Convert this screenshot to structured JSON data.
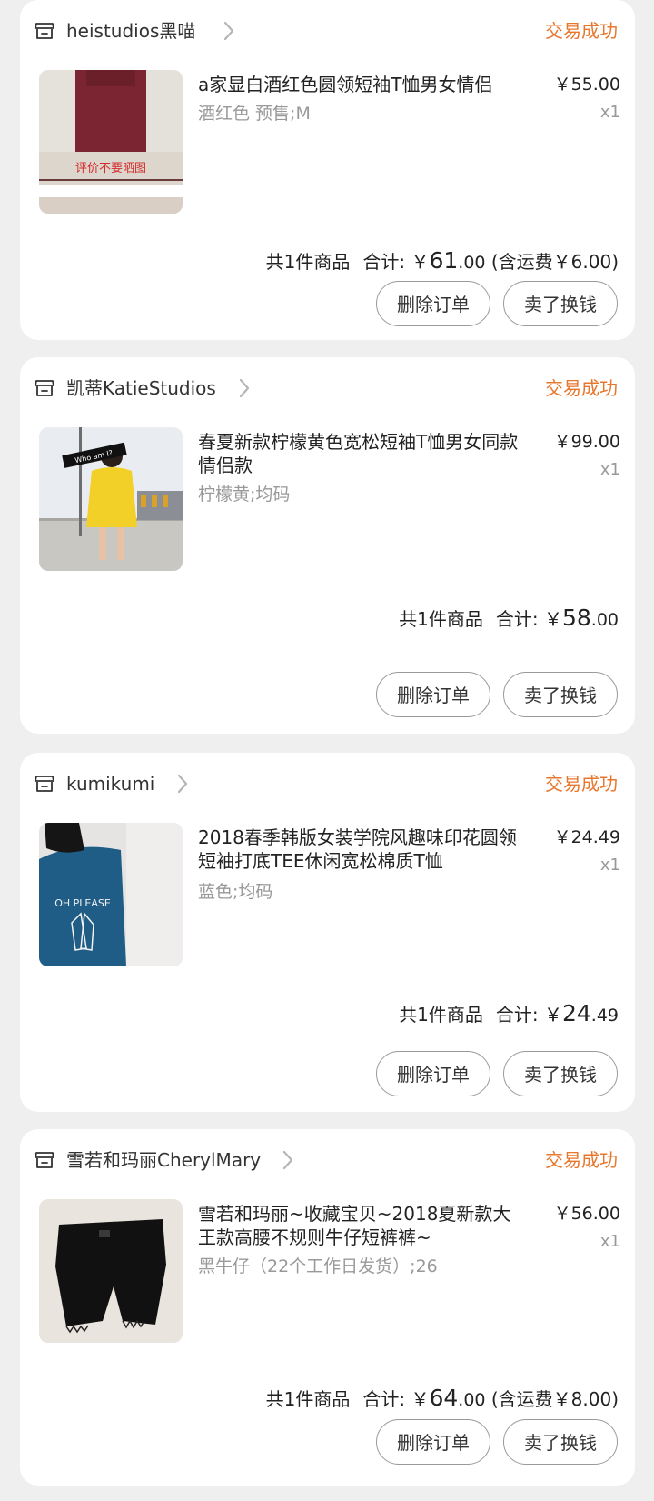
{
  "orders": [
    {
      "store_name": "heistudios黑喵",
      "status": "交易成功",
      "item_title": "a家显白酒红色圆领短袖T恤男女情侣",
      "item_spec": "酒红色 预售;M",
      "item_price": "￥55.00",
      "item_qty": "x1",
      "thumb_caption": "评价不要晒图",
      "count_label": "共1件商品",
      "total_label": "合计:",
      "total_yuan": "￥",
      "total_int": "61",
      "total_dec": ".00",
      "shipping_note": "(含运费￥6.00)",
      "delete_label": "删除订单",
      "sell_label": "卖了换钱"
    },
    {
      "store_name": "凯蒂KatieStudios",
      "status": "交易成功",
      "item_title": "春夏新款柠檬黄色宽松短袖T恤男女同款情侣款",
      "item_spec": "柠檬黄;均码",
      "item_price": "￥99.00",
      "item_qty": "x1",
      "thumb_caption": "Who am I?",
      "count_label": "共1件商品",
      "total_label": "合计:",
      "total_yuan": "￥",
      "total_int": "58",
      "total_dec": ".00",
      "shipping_note": "",
      "delete_label": "删除订单",
      "sell_label": "卖了换钱"
    },
    {
      "store_name": "kumikumi",
      "status": "交易成功",
      "item_title": "2018春季韩版女装学院风趣味印花圆领短袖打底TEE休闲宽松棉质T恤",
      "item_spec": "蓝色;均码",
      "item_price": "￥24.49",
      "item_qty": "x1",
      "thumb_caption": "OH PLEASE",
      "count_label": "共1件商品",
      "total_label": "合计:",
      "total_yuan": "￥",
      "total_int": "24",
      "total_dec": ".49",
      "shipping_note": "",
      "delete_label": "删除订单",
      "sell_label": "卖了换钱"
    },
    {
      "store_name": "雪若和玛丽CherylMary",
      "status": "交易成功",
      "item_title": "雪若和玛丽~收藏宝贝~2018夏新款大王款高腰不规则牛仔短裤裤~",
      "item_spec": "黑牛仔（22个工作日发货）;26",
      "item_price": "￥56.00",
      "item_qty": "x1",
      "thumb_caption": "",
      "count_label": "共1件商品",
      "total_label": "合计:",
      "total_yuan": "￥",
      "total_int": "64",
      "total_dec": ".00",
      "shipping_note": "(含运费￥8.00)",
      "delete_label": "删除订单",
      "sell_label": "卖了换钱"
    }
  ],
  "colors": {
    "status": "#e8772e",
    "page_bg": "#efefef",
    "card_bg": "#ffffff",
    "muted_text": "#999999"
  },
  "icons": {
    "store": "store-icon",
    "chevron": "chevron-right-icon"
  }
}
